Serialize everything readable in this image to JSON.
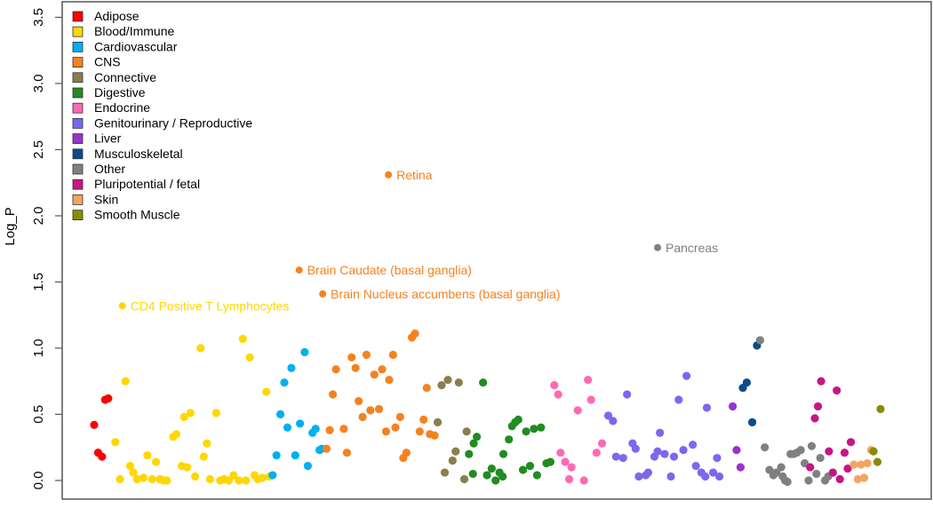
{
  "chart_data": {
    "type": "scatter",
    "title": "",
    "xlabel": "",
    "ylabel": "Log_P",
    "xlim": [
      0,
      100
    ],
    "ylim": [
      -0.13,
      3.6
    ],
    "yticks": [
      0.0,
      0.5,
      1.0,
      1.5,
      2.0,
      2.5,
      3.0,
      3.5
    ],
    "ytick_labels": [
      "0.0",
      "0.5",
      "1.0",
      "1.5",
      "2.0",
      "2.5",
      "3.0",
      "3.5"
    ],
    "x_ticks_shown": false,
    "grid": false,
    "legend_position": "top-left",
    "legend": [
      {
        "name": "Adipose",
        "color": "#ff0000"
      },
      {
        "name": "Blood/Immune",
        "color": "#ffd700"
      },
      {
        "name": "Cardiovascular",
        "color": "#00b0f0"
      },
      {
        "name": "CNS",
        "color": "#f58220"
      },
      {
        "name": "Connective",
        "color": "#8b7d4e"
      },
      {
        "name": "Digestive",
        "color": "#228b22"
      },
      {
        "name": "Endocrine",
        "color": "#ff69b4"
      },
      {
        "name": "Genitourinary / Reproductive",
        "color": "#7b68ee"
      },
      {
        "name": "Liver",
        "color": "#9932cc"
      },
      {
        "name": "Musculoskeletal",
        "color": "#0b4a8b"
      },
      {
        "name": "Other",
        "color": "#808080"
      },
      {
        "name": "Pluripotential / fetal",
        "color": "#c71585"
      },
      {
        "name": "Skin",
        "color": "#f4a460"
      },
      {
        "name": "Smooth Muscle",
        "color": "#8b8b00"
      }
    ],
    "series": [
      {
        "name": "Adipose",
        "points": [
          [
            4.7,
            0.42
          ],
          [
            5.2,
            0.21
          ],
          [
            5.7,
            0.18
          ],
          [
            6.1,
            0.61
          ],
          [
            6.5,
            0.62
          ]
        ]
      },
      {
        "name": "Blood/Immune",
        "points": [
          [
            7.4,
            0.29
          ],
          [
            8.0,
            0.01
          ],
          [
            8.7,
            0.75
          ],
          [
            9.3,
            0.11
          ],
          [
            9.7,
            0.06
          ],
          [
            10.2,
            0.01
          ],
          [
            11.0,
            0.02
          ],
          [
            11.5,
            0.19
          ],
          [
            12.1,
            0.01
          ],
          [
            12.6,
            0.14
          ],
          [
            13.1,
            0.01
          ],
          [
            13.6,
            0.0
          ],
          [
            14.0,
            0.0
          ],
          [
            14.8,
            0.33
          ],
          [
            15.2,
            0.35
          ],
          [
            15.9,
            0.11
          ],
          [
            16.2,
            0.48
          ],
          [
            16.6,
            0.1
          ],
          [
            17.0,
            0.51
          ],
          [
            17.6,
            0.03
          ],
          [
            18.3,
            1.0
          ],
          [
            18.7,
            0.18
          ],
          [
            19.1,
            0.28
          ],
          [
            19.5,
            0.01
          ],
          [
            20.3,
            0.51
          ],
          [
            20.8,
            0.0
          ],
          [
            21.3,
            0.01
          ],
          [
            21.9,
            0.0
          ],
          [
            22.5,
            0.04
          ],
          [
            23.2,
            0.0
          ],
          [
            23.7,
            1.07
          ],
          [
            24.1,
            0.0
          ],
          [
            24.6,
            0.93
          ],
          [
            25.2,
            0.04
          ],
          [
            25.6,
            0.01
          ],
          [
            26.2,
            0.02
          ],
          [
            26.7,
            0.67
          ],
          [
            27.1,
            0.03
          ],
          [
            8.3,
            1.32
          ]
        ],
        "labels": [
          {
            "index": 38,
            "text": "CD4 Positive T Lymphocytes"
          }
        ]
      },
      {
        "name": "Cardiovascular",
        "points": [
          [
            27.5,
            0.04
          ],
          [
            28.0,
            0.19
          ],
          [
            28.5,
            0.5
          ],
          [
            29.0,
            0.74
          ],
          [
            29.4,
            0.4
          ],
          [
            29.9,
            0.85
          ],
          [
            30.4,
            0.19
          ],
          [
            31.0,
            0.43
          ],
          [
            31.6,
            0.97
          ],
          [
            32.0,
            0.11
          ],
          [
            32.6,
            0.36
          ],
          [
            33.0,
            0.39
          ],
          [
            33.5,
            0.23
          ],
          [
            33.8,
            0.24
          ]
        ]
      },
      {
        "name": "CNS",
        "points": [
          [
            34.4,
            0.24
          ],
          [
            34.8,
            0.38
          ],
          [
            35.2,
            0.65
          ],
          [
            35.6,
            0.84
          ],
          [
            36.6,
            0.39
          ],
          [
            37.0,
            0.21
          ],
          [
            37.6,
            0.93
          ],
          [
            38.1,
            0.85
          ],
          [
            38.5,
            0.6
          ],
          [
            39.0,
            0.48
          ],
          [
            39.5,
            0.95
          ],
          [
            40.0,
            0.53
          ],
          [
            40.5,
            0.8
          ],
          [
            41.1,
            0.54
          ],
          [
            41.5,
            0.84
          ],
          [
            42.0,
            0.37
          ],
          [
            42.4,
            0.76
          ],
          [
            42.9,
            0.95
          ],
          [
            43.2,
            0.4
          ],
          [
            43.8,
            0.48
          ],
          [
            44.2,
            0.17
          ],
          [
            44.6,
            0.21
          ],
          [
            45.3,
            1.08
          ],
          [
            45.7,
            1.11
          ],
          [
            46.3,
            0.37
          ],
          [
            46.8,
            0.46
          ],
          [
            47.2,
            0.7
          ],
          [
            47.6,
            0.35
          ],
          [
            48.2,
            0.34
          ],
          [
            42.3,
            2.31
          ],
          [
            30.9,
            1.59
          ],
          [
            33.9,
            1.41
          ]
        ],
        "labels": [
          {
            "index": 29,
            "text": "Retina"
          },
          {
            "index": 30,
            "text": "Brain Caudate (basal ganglia)"
          },
          {
            "index": 31,
            "text": "Brain Nucleus accumbens (basal ganglia)"
          }
        ]
      },
      {
        "name": "Connective",
        "points": [
          [
            48.6,
            0.44
          ],
          [
            49.1,
            0.72
          ],
          [
            49.5,
            0.06
          ],
          [
            49.9,
            0.76
          ],
          [
            50.5,
            0.15
          ],
          [
            50.9,
            0.22
          ],
          [
            51.3,
            0.74
          ],
          [
            52.0,
            0.01
          ],
          [
            52.3,
            0.37
          ]
        ]
      },
      {
        "name": "Digestive",
        "points": [
          [
            52.6,
            0.2
          ],
          [
            53.2,
            0.28
          ],
          [
            53.6,
            0.33
          ],
          [
            53.1,
            0.05
          ],
          [
            54.4,
            0.74
          ],
          [
            54.9,
            0.04
          ],
          [
            55.5,
            0.09
          ],
          [
            56.0,
            0.0
          ],
          [
            56.5,
            0.06
          ],
          [
            56.9,
            0.03
          ],
          [
            57.0,
            0.2
          ],
          [
            57.7,
            0.31
          ],
          [
            58.1,
            0.41
          ],
          [
            58.5,
            0.44
          ],
          [
            58.9,
            0.46
          ],
          [
            59.5,
            0.08
          ],
          [
            59.9,
            0.37
          ],
          [
            60.4,
            0.11
          ],
          [
            60.9,
            0.39
          ],
          [
            61.3,
            0.04
          ],
          [
            61.8,
            0.4
          ],
          [
            62.5,
            0.13
          ],
          [
            63.0,
            0.14
          ]
        ]
      },
      {
        "name": "Endocrine",
        "points": [
          [
            63.5,
            0.72
          ],
          [
            64.0,
            0.65
          ],
          [
            64.3,
            0.21
          ],
          [
            64.9,
            0.14
          ],
          [
            65.4,
            0.01
          ],
          [
            65.7,
            0.1
          ],
          [
            66.5,
            0.53
          ],
          [
            67.3,
            0.0
          ],
          [
            67.8,
            0.76
          ],
          [
            68.2,
            0.61
          ],
          [
            68.9,
            0.21
          ],
          [
            69.6,
            0.28
          ]
        ]
      },
      {
        "name": "Genitourinary / Reproductive",
        "points": [
          [
            70.4,
            0.49
          ],
          [
            71.0,
            0.45
          ],
          [
            71.4,
            0.18
          ],
          [
            72.3,
            0.17
          ],
          [
            72.8,
            0.65
          ],
          [
            73.5,
            0.28
          ],
          [
            73.9,
            0.24
          ],
          [
            74.3,
            0.03
          ],
          [
            75.2,
            0.04
          ],
          [
            75.5,
            0.06
          ],
          [
            76.3,
            0.18
          ],
          [
            76.7,
            0.22
          ],
          [
            77.0,
            0.36
          ],
          [
            77.6,
            0.2
          ],
          [
            78.4,
            0.03
          ],
          [
            78.8,
            0.18
          ],
          [
            79.4,
            0.61
          ],
          [
            80.0,
            0.23
          ],
          [
            80.4,
            0.79
          ],
          [
            81.2,
            0.27
          ],
          [
            81.6,
            0.11
          ],
          [
            82.3,
            0.06
          ],
          [
            82.8,
            0.03
          ],
          [
            83.0,
            0.55
          ],
          [
            83.8,
            0.06
          ],
          [
            84.3,
            0.17
          ],
          [
            84.6,
            0.03
          ]
        ]
      },
      {
        "name": "Liver",
        "points": [
          [
            86.3,
            0.56
          ],
          [
            86.8,
            0.23
          ],
          [
            87.3,
            0.1
          ]
        ]
      },
      {
        "name": "Musculoskeletal",
        "points": [
          [
            87.6,
            0.7
          ],
          [
            88.1,
            0.74
          ],
          [
            88.8,
            0.44
          ],
          [
            89.4,
            1.02
          ]
        ]
      },
      {
        "name": "Other",
        "points": [
          [
            89.8,
            1.06
          ],
          [
            90.4,
            0.25
          ],
          [
            91.0,
            0.08
          ],
          [
            91.5,
            0.04
          ],
          [
            91.9,
            0.06
          ],
          [
            92.5,
            0.1
          ],
          [
            92.7,
            0.03
          ],
          [
            93.0,
            0.0
          ],
          [
            93.3,
            -0.01
          ],
          [
            93.7,
            0.2
          ],
          [
            94.1,
            0.2
          ],
          [
            94.5,
            0.21
          ],
          [
            95.0,
            0.23
          ],
          [
            95.5,
            0.13
          ],
          [
            96.0,
            0.0
          ],
          [
            96.4,
            0.26
          ],
          [
            97.0,
            0.05
          ],
          [
            97.5,
            0.17
          ],
          [
            98.1,
            0.0
          ],
          [
            98.5,
            0.03
          ],
          [
            76.7,
            1.76
          ]
        ],
        "labels": [
          {
            "index": 20,
            "text": "Pancreas"
          }
        ]
      },
      {
        "name": "Pluripotential / fetal",
        "points": [
          [
            96.2,
            0.1
          ],
          [
            96.8,
            0.47
          ],
          [
            97.2,
            0.56
          ],
          [
            97.6,
            0.75
          ],
          [
            98.6,
            0.22
          ],
          [
            99.1,
            0.06
          ],
          [
            99.6,
            0.68
          ],
          [
            100.0,
            0.01
          ],
          [
            100.6,
            0.21
          ],
          [
            101.0,
            0.09
          ],
          [
            101.4,
            0.29
          ]
        ]
      },
      {
        "name": "Skin",
        "points": [
          [
            101.8,
            0.12
          ],
          [
            102.3,
            0.01
          ],
          [
            102.7,
            0.12
          ],
          [
            103.1,
            0.02
          ],
          [
            103.5,
            0.13
          ],
          [
            104.0,
            0.23
          ]
        ]
      },
      {
        "name": "Smooth Muscle",
        "points": [
          [
            104.3,
            0.22
          ],
          [
            104.8,
            0.14
          ],
          [
            105.2,
            0.54
          ]
        ]
      }
    ]
  }
}
